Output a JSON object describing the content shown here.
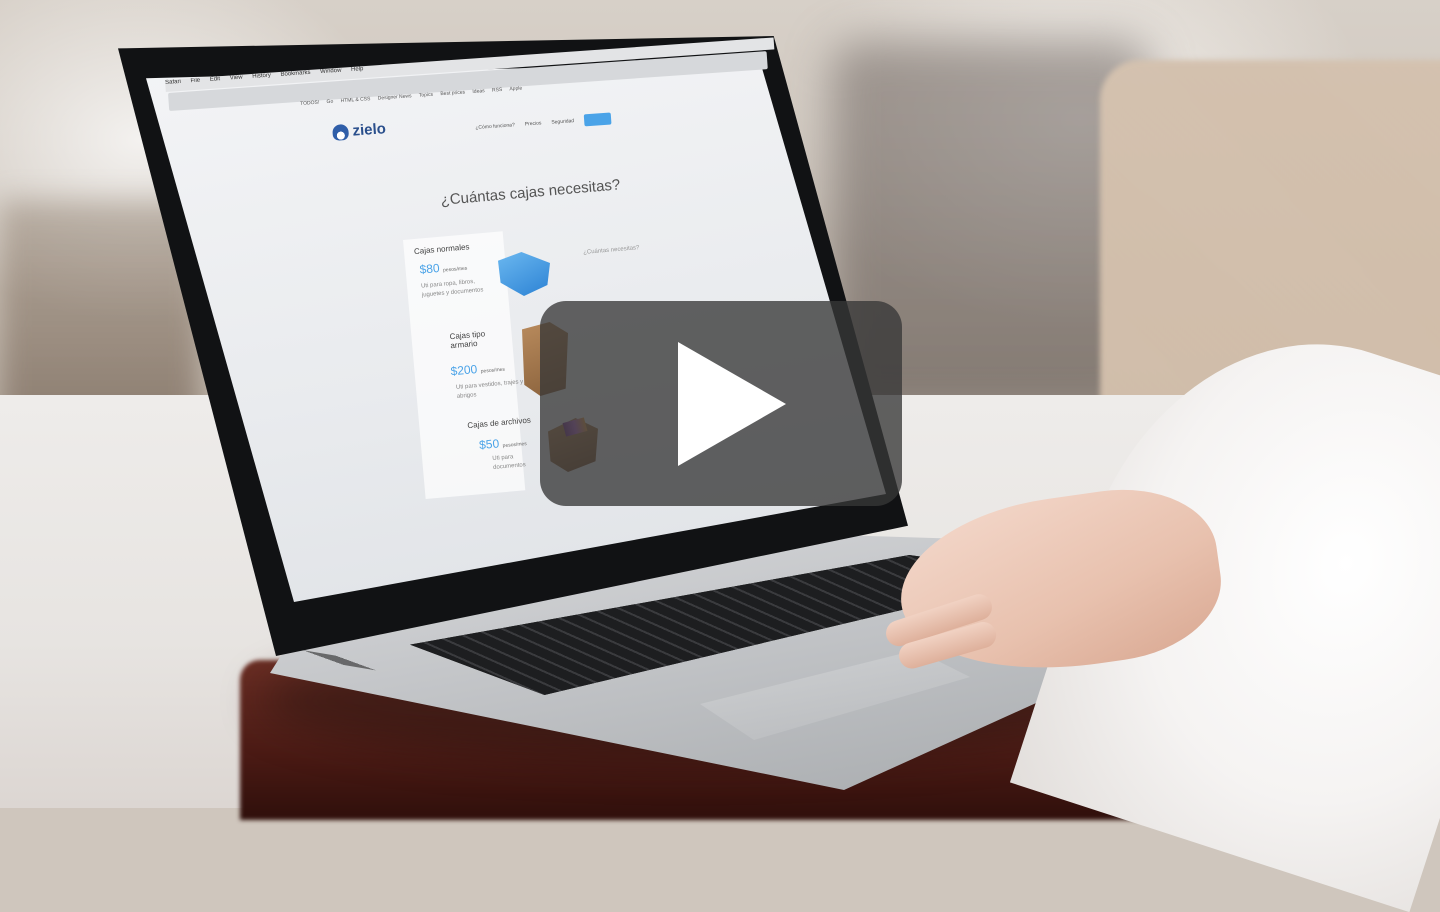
{
  "laptop_screen": {
    "menubar": [
      "Safari",
      "File",
      "Edit",
      "View",
      "History",
      "Bookmarks",
      "Window",
      "Help"
    ],
    "bookmarks": [
      "TODOS!",
      "Go",
      "HTML & CSS",
      "Designer News",
      "Topics",
      "Best prices",
      "Ideas",
      "RSS",
      "Apple"
    ],
    "site": {
      "logo": "zielo",
      "nav": [
        "¿Cómo funciona?",
        "Precios",
        "Seguridad"
      ],
      "headline": "¿Cuántas cajas necesitas?",
      "products": [
        {
          "title": "Cajas normales",
          "price": "$80",
          "price_suffix": "pesos/mes",
          "desc": "Uti para ropa, libros, juguetes y documentos"
        },
        {
          "title": "Cajas tipo armario",
          "price": "$200",
          "price_suffix": "pesos/mes",
          "desc": "Uti para vestidos, trajes y abrigos"
        },
        {
          "title": "Cajas de archivos",
          "price": "$50",
          "price_suffix": "pesos/mes",
          "desc": "Uti para documentos"
        }
      ],
      "side_label": "¿Cuántas necesitas?"
    }
  },
  "player": {
    "play_icon": "play-icon",
    "overlay_color": "#373737"
  }
}
